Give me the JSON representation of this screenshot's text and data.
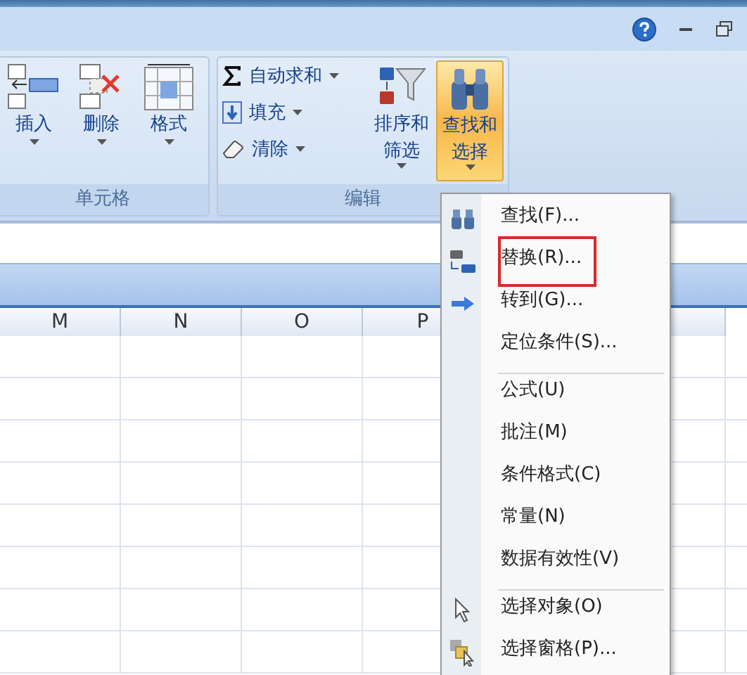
{
  "ribbon": {
    "groups": [
      {
        "label": "单元格",
        "kind": "cells",
        "buttons": [
          {
            "lines": [
              "插入"
            ],
            "kind": "insert",
            "dropdown": true,
            "selected": false
          },
          {
            "lines": [
              "删除"
            ],
            "kind": "delete",
            "dropdown": true,
            "selected": false
          },
          {
            "lines": [
              "格式"
            ],
            "kind": "format",
            "dropdown": true,
            "selected": false
          }
        ]
      },
      {
        "label": "编辑",
        "kind": "editing",
        "small_buttons": [
          {
            "label": "自动求和",
            "kind": "sum",
            "dropdown": true
          },
          {
            "label": "填充",
            "kind": "fill",
            "dropdown": true
          },
          {
            "label": "清除",
            "kind": "clear",
            "dropdown": true
          }
        ],
        "buttons": [
          {
            "lines": [
              "排序和",
              "筛选"
            ],
            "kind": "sort",
            "dropdown": true,
            "selected": false
          },
          {
            "lines": [
              "查找和",
              "选择"
            ],
            "kind": "find",
            "dropdown": true,
            "selected": true
          }
        ]
      }
    ]
  },
  "columns": [
    "M",
    "N",
    "O",
    "P"
  ],
  "menu": {
    "items": [
      {
        "label": "查找(F)...",
        "kind": "find",
        "highlighted": false,
        "separator_before": false
      },
      {
        "label": "替换(R)...",
        "kind": "replace",
        "highlighted": true,
        "separator_before": false
      },
      {
        "label": "转到(G)...",
        "kind": "goto",
        "highlighted": false,
        "separator_before": false
      },
      {
        "label": "定位条件(S)...",
        "kind": "plain",
        "highlighted": false,
        "separator_before": false
      },
      {
        "label": "公式(U)",
        "kind": "plain",
        "highlighted": false,
        "separator_before": true
      },
      {
        "label": "批注(M)",
        "kind": "plain",
        "highlighted": false,
        "separator_before": false
      },
      {
        "label": "条件格式(C)",
        "kind": "plain",
        "highlighted": false,
        "separator_before": false
      },
      {
        "label": "常量(N)",
        "kind": "plain",
        "highlighted": false,
        "separator_before": false
      },
      {
        "label": "数据有效性(V)",
        "kind": "plain",
        "highlighted": false,
        "separator_before": false
      },
      {
        "label": "选择对象(O)",
        "kind": "select",
        "highlighted": false,
        "separator_before": true
      },
      {
        "label": "选择窗格(P)...",
        "kind": "pane",
        "highlighted": false,
        "separator_before": false
      }
    ]
  }
}
